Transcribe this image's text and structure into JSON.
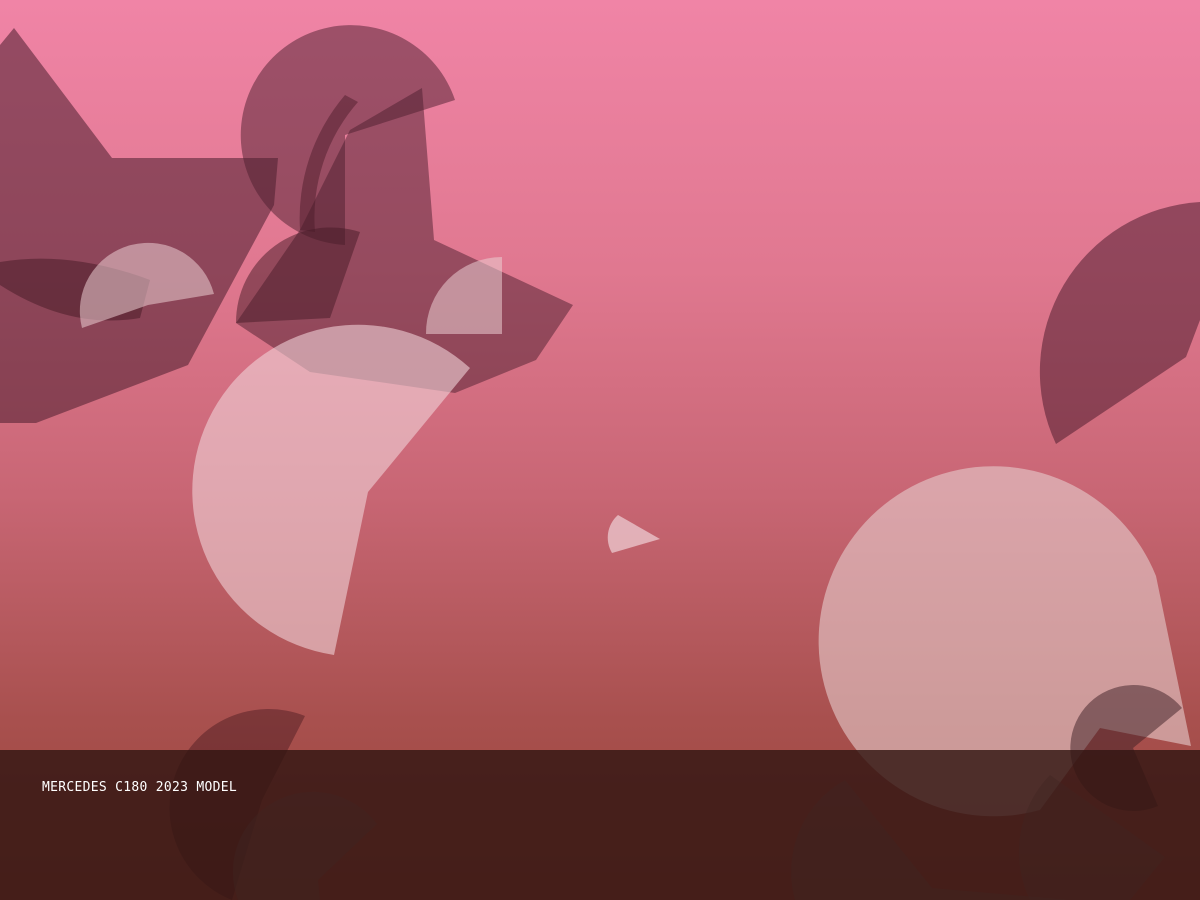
{
  "caption": {
    "text": "MERCEDES C180 2023 MODEL"
  },
  "palette": {
    "background_top": "#f084a6",
    "background_bottom": "#9a4438",
    "dark_shape": "#5a2a36",
    "light_shape": "#e8c4c8",
    "caption_bar": "#321612",
    "caption_text": "#ffffff"
  }
}
